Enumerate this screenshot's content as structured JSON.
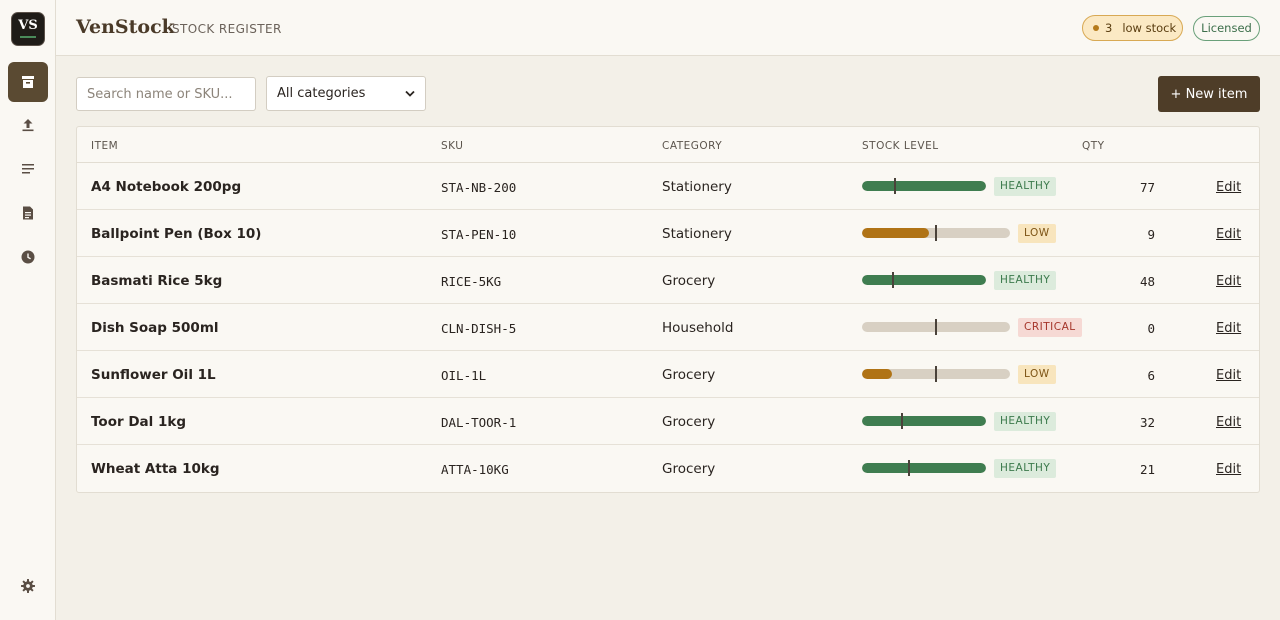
{
  "app": {
    "logo": "VS",
    "brand": "VenStock",
    "subtitle": "STOCK REGISTER"
  },
  "header": {
    "low_stock_count": "3",
    "low_stock_label": "low stock",
    "license_label": "Licensed"
  },
  "sidebar": {
    "items": [
      {
        "name": "inventory",
        "icon": "archive-box-icon",
        "active": true
      },
      {
        "name": "import",
        "icon": "upload-icon",
        "active": false
      },
      {
        "name": "list",
        "icon": "list-icon",
        "active": false
      },
      {
        "name": "reports",
        "icon": "document-icon",
        "active": false
      },
      {
        "name": "history",
        "icon": "clock-icon",
        "active": false
      }
    ],
    "footer_icon": "gear-icon"
  },
  "toolbar": {
    "search_placeholder": "Search name or SKU...",
    "category_selected": "All categories",
    "new_item_label": "+ New item"
  },
  "table": {
    "headers": {
      "item": "ITEM",
      "sku": "SKU",
      "category": "CATEGORY",
      "stock_level": "STOCK LEVEL",
      "qty": "QTY"
    },
    "rows": [
      {
        "item": "A4 Notebook 200pg",
        "sku": "STA-NB-200",
        "category": "Stationery",
        "level": 1.0,
        "threshold": 0.27,
        "status": "HEALTHY",
        "qty": "77",
        "edit": "Edit"
      },
      {
        "item": "Ballpoint Pen (Box 10)",
        "sku": "STA-PEN-10",
        "category": "Stationery",
        "level": 0.45,
        "threshold": 0.5,
        "status": "LOW",
        "qty": "9",
        "edit": "Edit"
      },
      {
        "item": "Basmati Rice 5kg",
        "sku": "RICE-5KG",
        "category": "Grocery",
        "level": 1.0,
        "threshold": 0.25,
        "status": "HEALTHY",
        "qty": "48",
        "edit": "Edit"
      },
      {
        "item": "Dish Soap 500ml",
        "sku": "CLN-DISH-5",
        "category": "Household",
        "level": 0.0,
        "threshold": 0.5,
        "status": "CRITICAL",
        "qty": "0",
        "edit": "Edit"
      },
      {
        "item": "Sunflower Oil 1L",
        "sku": "OIL-1L",
        "category": "Grocery",
        "level": 0.2,
        "threshold": 0.5,
        "status": "LOW",
        "qty": "6",
        "edit": "Edit"
      },
      {
        "item": "Toor Dal 1kg",
        "sku": "DAL-TOOR-1",
        "category": "Grocery",
        "level": 1.0,
        "threshold": 0.32,
        "status": "HEALTHY",
        "qty": "32",
        "edit": "Edit"
      },
      {
        "item": "Wheat Atta 10kg",
        "sku": "ATTA-10KG",
        "category": "Grocery",
        "level": 1.0,
        "threshold": 0.38,
        "status": "HEALTHY",
        "qty": "21",
        "edit": "Edit"
      }
    ]
  },
  "colors": {
    "healthy": "#3f7d50",
    "low": "#b07315",
    "critical": "#c0453a",
    "accent": "#4e3d28"
  }
}
